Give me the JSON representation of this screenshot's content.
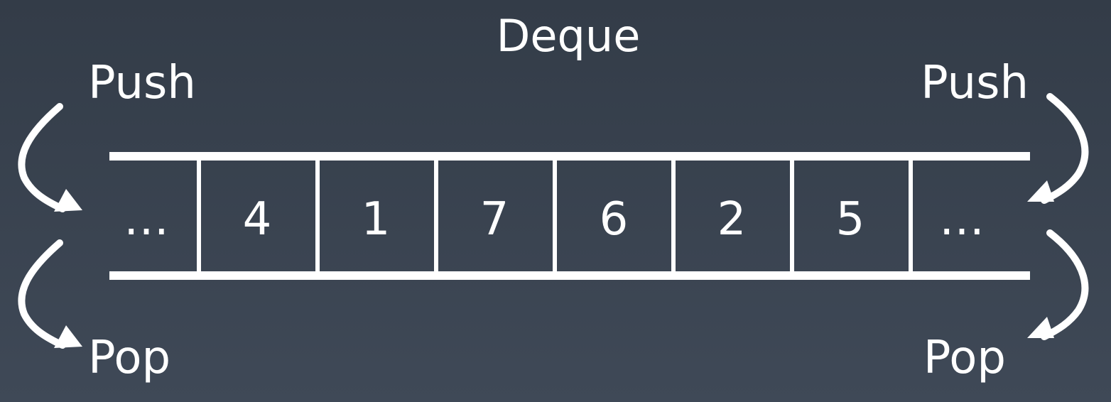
{
  "title": "Deque",
  "labels": {
    "push_left": "Push",
    "push_right": "Push",
    "pop_left": "Pop",
    "pop_right": "Pop"
  },
  "cells": [
    "…",
    "4",
    "1",
    "7",
    "6",
    "2",
    "5",
    "…"
  ],
  "colors": {
    "background_top": "#333c48",
    "background_bottom": "#3f4957",
    "foreground": "#ffffff"
  }
}
